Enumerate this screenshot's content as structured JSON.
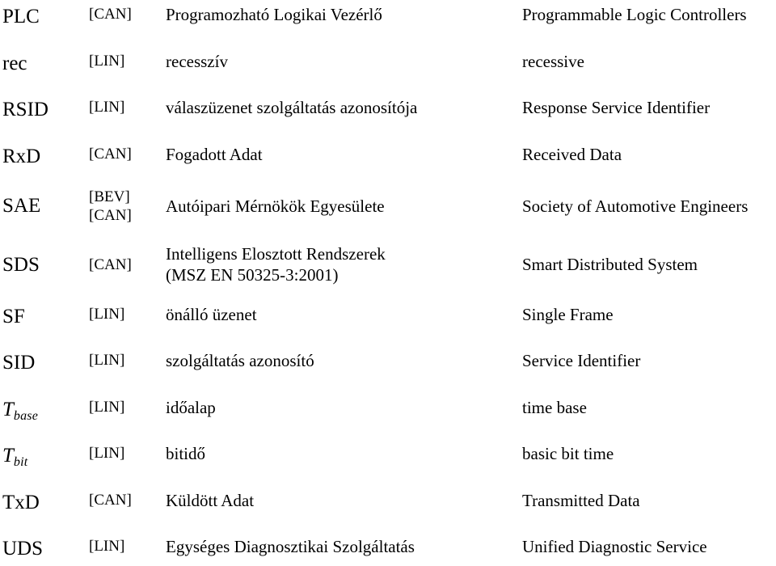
{
  "document": {
    "type": "glossary-table",
    "language_pair": "Hungarian-English",
    "columns": [
      "abbreviation",
      "bus",
      "hungarian",
      "english"
    ]
  },
  "rows": [
    {
      "abbr": "PLC",
      "abbr_style": "upright",
      "bus": [
        "[CAN]"
      ],
      "hungarian": [
        "Programozható Logikai Vezérlő"
      ],
      "english": "Programmable Logic Controllers"
    },
    {
      "abbr": "rec",
      "abbr_style": "upright",
      "bus": [
        "[LIN]"
      ],
      "hungarian": [
        "recesszív"
      ],
      "english": "recessive"
    },
    {
      "abbr": "RSID",
      "abbr_style": "upright",
      "bus": [
        "[LIN]"
      ],
      "hungarian": [
        "válaszüzenet szolgáltatás azonosítója"
      ],
      "english": "Response Service Identifier"
    },
    {
      "abbr": "RxD",
      "abbr_style": "upright",
      "bus": [
        "[CAN]"
      ],
      "hungarian": [
        "Fogadott Adat"
      ],
      "english": "Received Data"
    },
    {
      "abbr": "SAE",
      "abbr_style": "upright",
      "bus": [
        "[BEV]",
        "[CAN]"
      ],
      "hungarian": [
        "Autóipari Mérnökök Egyesülete"
      ],
      "english": "Society of Automotive Engineers"
    },
    {
      "abbr": "SDS",
      "abbr_style": "upright",
      "bus": [
        "[CAN]"
      ],
      "hungarian": [
        "Intelligens Elosztott Rendszerek",
        "(MSZ EN 50325-3:2001)"
      ],
      "english": "Smart Distributed System"
    },
    {
      "abbr": "SF",
      "abbr_style": "upright",
      "bus": [
        "[LIN]"
      ],
      "hungarian": [
        "önálló üzenet"
      ],
      "english": "Single Frame"
    },
    {
      "abbr": "SID",
      "abbr_style": "upright",
      "bus": [
        "[LIN]"
      ],
      "hungarian": [
        "szolgáltatás azonosító"
      ],
      "english": "Service Identifier"
    },
    {
      "abbr": "T",
      "abbr_sub": "base",
      "abbr_style": "italic-with-subscript",
      "bus": [
        "[LIN]"
      ],
      "hungarian": [
        "időalap"
      ],
      "english": "time base"
    },
    {
      "abbr": "T",
      "abbr_sub": "bit",
      "abbr_style": "italic-with-subscript",
      "bus": [
        "[LIN]"
      ],
      "hungarian": [
        "bitidő"
      ],
      "english": "basic bit time"
    },
    {
      "abbr": "TxD",
      "abbr_style": "upright",
      "bus": [
        "[CAN]"
      ],
      "hungarian": [
        "Küldött Adat"
      ],
      "english": "Transmitted Data"
    },
    {
      "abbr": "UDS",
      "abbr_style": "upright",
      "bus": [
        "[LIN]"
      ],
      "hungarian": [
        "Egységes Diagnosztikai Szolgáltatás"
      ],
      "english": "Unified Diagnostic Service"
    }
  ]
}
